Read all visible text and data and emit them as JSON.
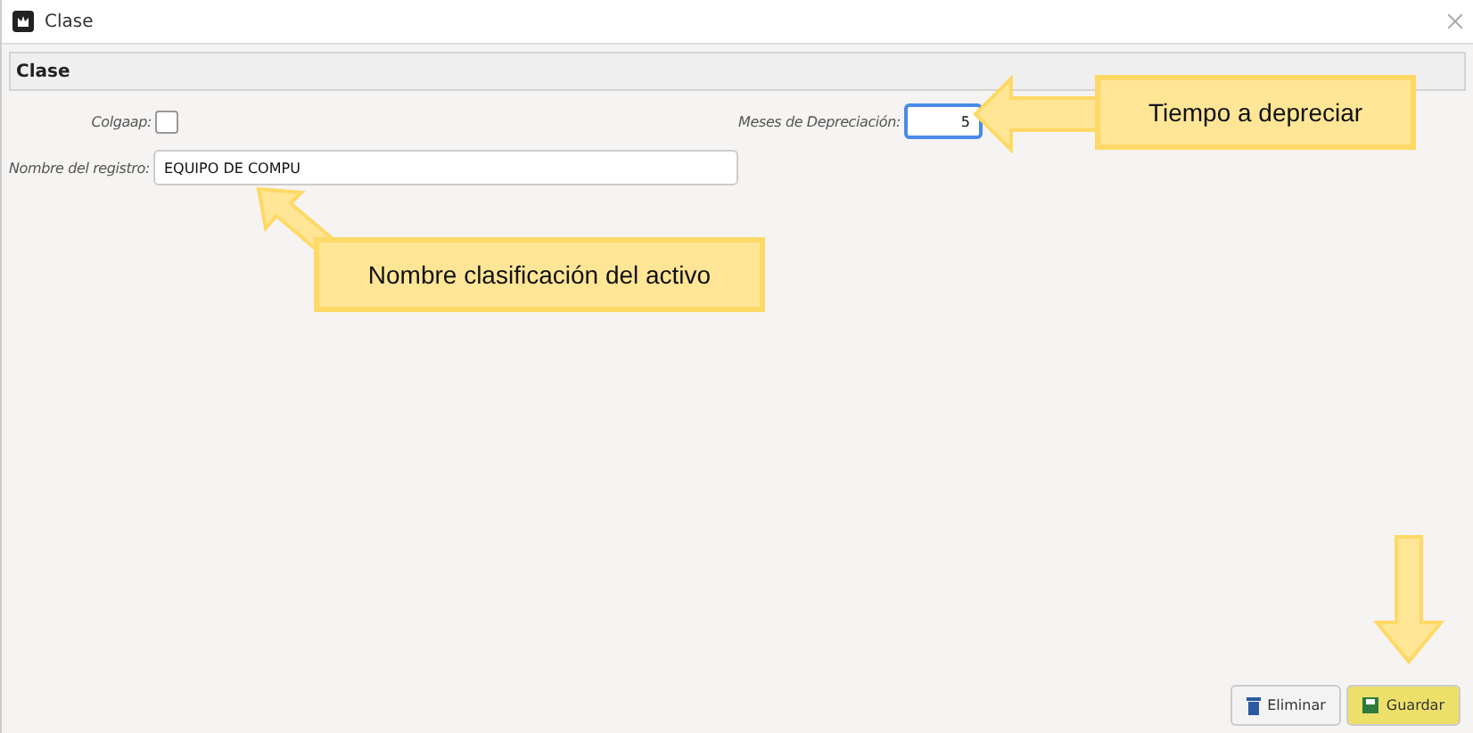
{
  "window": {
    "title": "Clase"
  },
  "section": {
    "title": "Clase"
  },
  "form": {
    "colgaap": {
      "label": "Colgaap:",
      "checked": false
    },
    "months": {
      "label": "Meses de Depreciación:",
      "value": "5"
    },
    "name": {
      "label": "Nombre del registro:",
      "value": "EQUIPO DE COMPU"
    }
  },
  "buttons": [
    {
      "kind": "delete",
      "label": "Eliminar",
      "highlighted": false
    },
    {
      "kind": "save",
      "label": "Guardar",
      "highlighted": true
    }
  ],
  "callouts": [
    {
      "text": "Tiempo a depreciar"
    },
    {
      "text": "Nombre clasificación del activo"
    }
  ]
}
